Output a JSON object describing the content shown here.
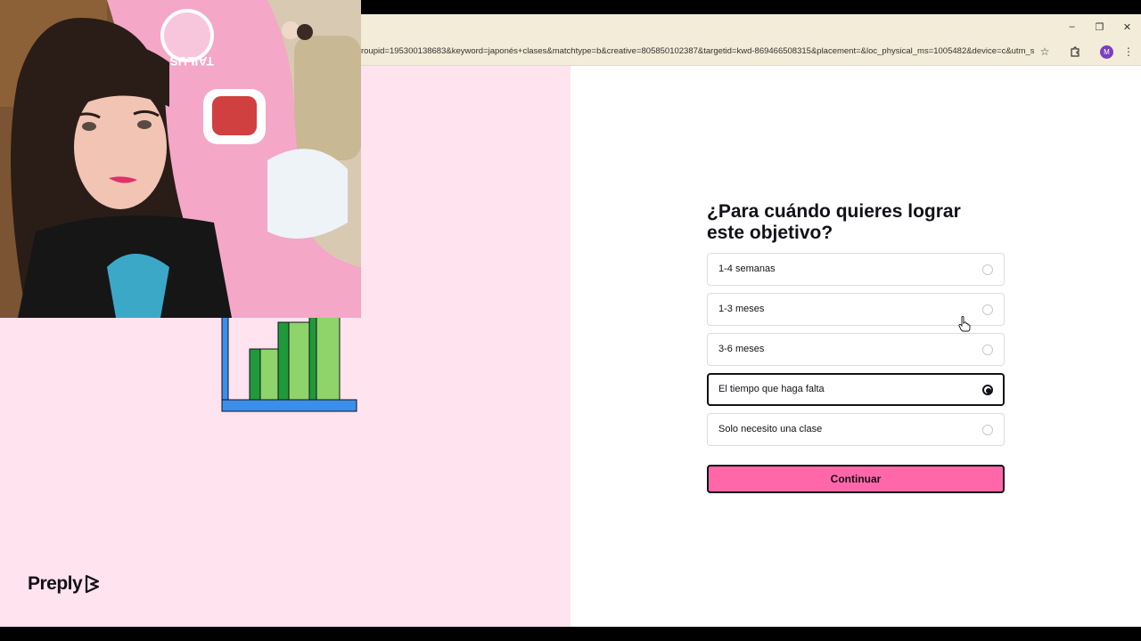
{
  "browser": {
    "url": "roupid=195300138683&keyword=japonés+clases&matchtype=b&creative=805850102387&targetid=kwd-869466508315&placement=&loc_physical_ms=1005482&device=c&utm_s...",
    "profile_initial": "M"
  },
  "webcam": {
    "chair_brand": "TAILUS"
  },
  "quiz": {
    "question": "¿Para cuándo quieres lograr este objetivo?",
    "options": [
      {
        "label": "1-4 semanas",
        "selected": false
      },
      {
        "label": "1-3 meses",
        "selected": false
      },
      {
        "label": "3-6 meses",
        "selected": false
      },
      {
        "label": "El tiempo que haga falta",
        "selected": true
      },
      {
        "label": "Solo necesito una clase",
        "selected": false
      }
    ],
    "continue_label": "Continuar"
  },
  "brand": {
    "logo_text": "Preply"
  },
  "colors": {
    "left_panel": "#ffe3ef",
    "button": "#ff67a9",
    "chart_blue": "#3b8fea",
    "chart_green": "#8fd36b",
    "chart_dark_green": "#1f9a3a"
  }
}
